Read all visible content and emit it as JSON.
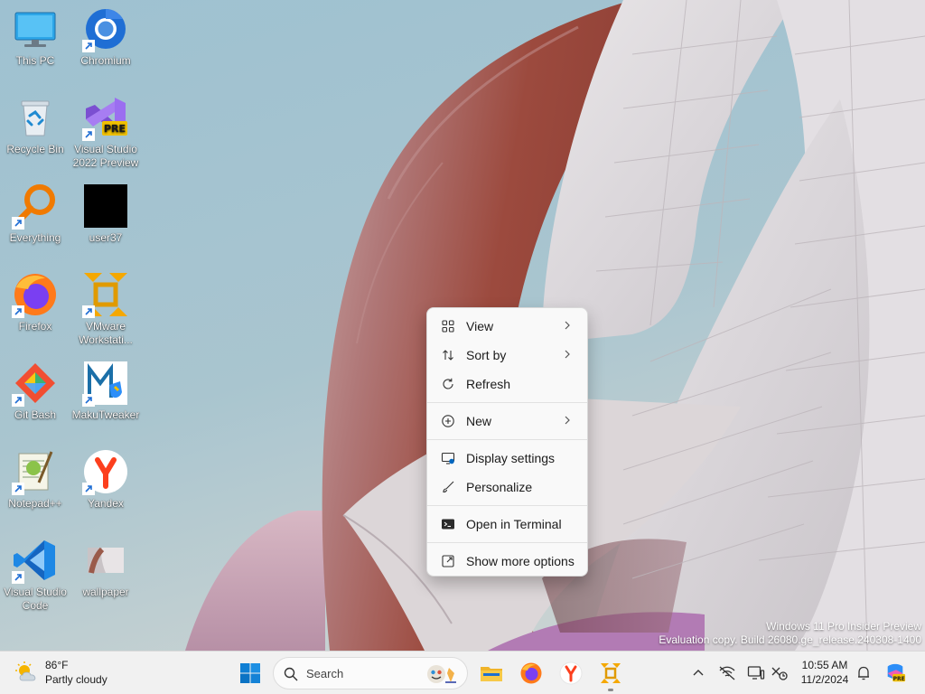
{
  "desktop": {
    "icons": [
      {
        "label": "This PC",
        "icon": "monitor-icon"
      },
      {
        "label": "Chromium",
        "icon": "chromium-icon"
      },
      {
        "label": "Recycle Bin",
        "icon": "recycle-bin-icon"
      },
      {
        "label": "Visual Studio 2022 Preview",
        "icon": "visual-studio-preview-icon",
        "badge": "PRE"
      },
      {
        "label": "Everything",
        "icon": "everything-search-icon"
      },
      {
        "label": "user37",
        "icon": "user-folder-icon"
      },
      {
        "label": "Firefox",
        "icon": "firefox-icon"
      },
      {
        "label": "VMware Workstati...",
        "icon": "vmware-icon"
      },
      {
        "label": "Git Bash",
        "icon": "git-bash-icon"
      },
      {
        "label": "MakuTweaker",
        "icon": "makutweaker-icon"
      },
      {
        "label": "Notepad++",
        "icon": "notepad-plus-plus-icon"
      },
      {
        "label": "Yandex",
        "icon": "yandex-browser-icon"
      },
      {
        "label": "Visual Studio Code",
        "icon": "vscode-icon"
      },
      {
        "label": "wallpaper",
        "icon": "image-file-icon"
      }
    ]
  },
  "context_menu": {
    "items": [
      {
        "label": "View",
        "icon": "grid-view-icon",
        "submenu": true
      },
      {
        "label": "Sort by",
        "icon": "sort-icon",
        "submenu": true
      },
      {
        "label": "Refresh",
        "icon": "refresh-icon",
        "submenu": false
      },
      {
        "label": "New",
        "icon": "new-plus-icon",
        "submenu": true
      },
      {
        "label": "Display settings",
        "icon": "display-settings-icon",
        "submenu": false
      },
      {
        "label": "Personalize",
        "icon": "paintbrush-icon",
        "submenu": false
      },
      {
        "label": "Open in Terminal",
        "icon": "terminal-icon",
        "submenu": false
      },
      {
        "label": "Show more options",
        "icon": "show-more-options-icon",
        "submenu": false
      }
    ]
  },
  "watermark": {
    "line1": "Windows 11 Pro Insider Preview",
    "line2": "Evaluation copy. Build 26080.ge_release.240308-1400"
  },
  "taskbar": {
    "weather": {
      "temp": "86°F",
      "condition": "Partly cloudy"
    },
    "search_placeholder": "Search",
    "apps": [
      "start-icon",
      "file-explorer-icon",
      "firefox-icon",
      "yandex-browser-icon",
      "vmware-icon"
    ],
    "clock": {
      "time": "10:55 AM",
      "date": "11/2/2024"
    }
  },
  "colors": {
    "sky": "#a9c6d3",
    "menu_bg": "#f9f9f9",
    "taskbar_bg": "#f1f1f1",
    "accent": "#0067c0"
  }
}
